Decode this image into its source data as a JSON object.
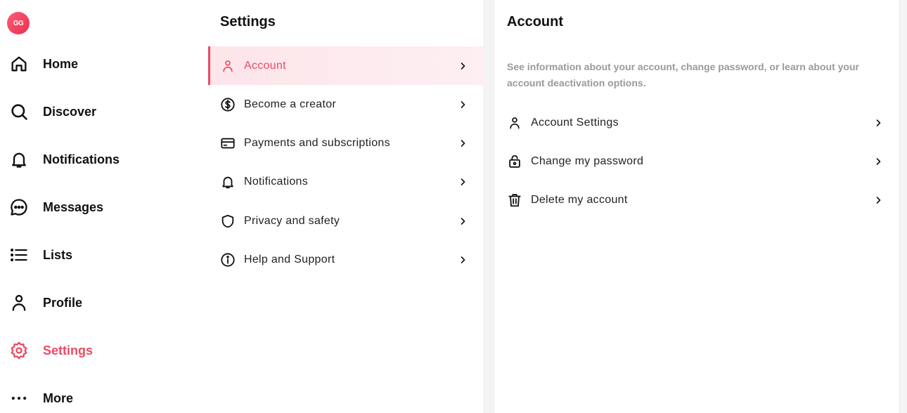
{
  "user": {
    "avatar_initials": "GG"
  },
  "nav": {
    "items": [
      {
        "label": "Home",
        "icon": "home-icon"
      },
      {
        "label": "Discover",
        "icon": "search-icon"
      },
      {
        "label": "Notifications",
        "icon": "bell-icon"
      },
      {
        "label": "Messages",
        "icon": "chat-icon"
      },
      {
        "label": "Lists",
        "icon": "list-icon"
      },
      {
        "label": "Profile",
        "icon": "user-icon"
      },
      {
        "label": "Settings",
        "icon": "gear-icon",
        "active": true
      },
      {
        "label": "More",
        "icon": "more-dots-icon"
      }
    ]
  },
  "settings": {
    "title": "Settings",
    "items": [
      {
        "label": "Account",
        "icon": "user-icon",
        "active": true
      },
      {
        "label": "Become a creator",
        "icon": "dollar-circle-icon"
      },
      {
        "label": "Payments and subscriptions",
        "icon": "credit-card-icon"
      },
      {
        "label": "Notifications",
        "icon": "bell-icon"
      },
      {
        "label": "Privacy and safety",
        "icon": "shield-icon"
      },
      {
        "label": "Help and Support",
        "icon": "info-icon"
      }
    ]
  },
  "account": {
    "title": "Account",
    "description": "See information about your account, change password, or learn about your account deactivation options.",
    "items": [
      {
        "label": "Account Settings",
        "icon": "user-icon"
      },
      {
        "label": "Change my password",
        "icon": "lock-icon"
      },
      {
        "label": "Delete my account",
        "icon": "trash-icon"
      }
    ]
  },
  "colors": {
    "accent": "#ea4a64",
    "active_bg": "#fde5ea",
    "text": "#111111",
    "muted": "#9a9a9a",
    "background": "#f4f4f5"
  }
}
